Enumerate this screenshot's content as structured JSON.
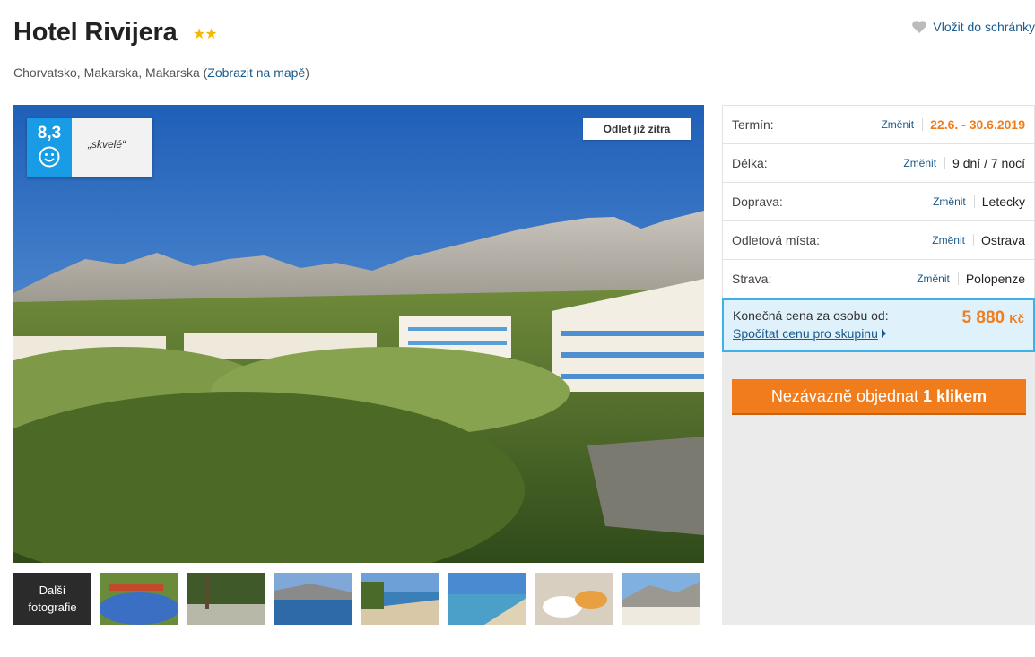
{
  "hotel": {
    "name": "Hotel Rivijera",
    "stars": "★★",
    "location_text": "Chorvatsko, Makarska, Makarska (",
    "map_link": "Zobrazit na mapě",
    "location_end": ")"
  },
  "favorite": {
    "label": "Vložit do schránky",
    "icon": "heart-icon"
  },
  "hero": {
    "rating_score": "8,3",
    "rating_label": "„skvelé“",
    "depart_badge": "Odlet již zítra"
  },
  "gallery": {
    "more_line1": "Další",
    "more_line2": "fotografie",
    "thumbnails": [
      "thumb-pool",
      "thumb-garden",
      "thumb-coast",
      "thumb-beach",
      "thumb-shore",
      "thumb-food",
      "thumb-town"
    ]
  },
  "booking": {
    "change_label": "Změnit",
    "rows": [
      {
        "label": "Termín:",
        "value": "22.6. - 30.6.2019"
      },
      {
        "label": "Délka:",
        "value": "9 dní / 7 nocí"
      },
      {
        "label": "Doprava:",
        "value": "Letecky"
      },
      {
        "label": "Odletová místa:",
        "value": "Ostrava"
      },
      {
        "label": "Strava:",
        "value": "Polopenze"
      }
    ],
    "price_label": "Konečná cena za osobu od:",
    "price_amount": "5 880",
    "price_currency": "Kč",
    "group_link": "Spočítat cenu pro skupinu",
    "order_prefix": "Nezávazně objednat",
    "order_bold": "1 klikem"
  },
  "colors": {
    "accent": "#f07c1c",
    "link": "#1a5a8c",
    "rating": "#1a9be6"
  }
}
